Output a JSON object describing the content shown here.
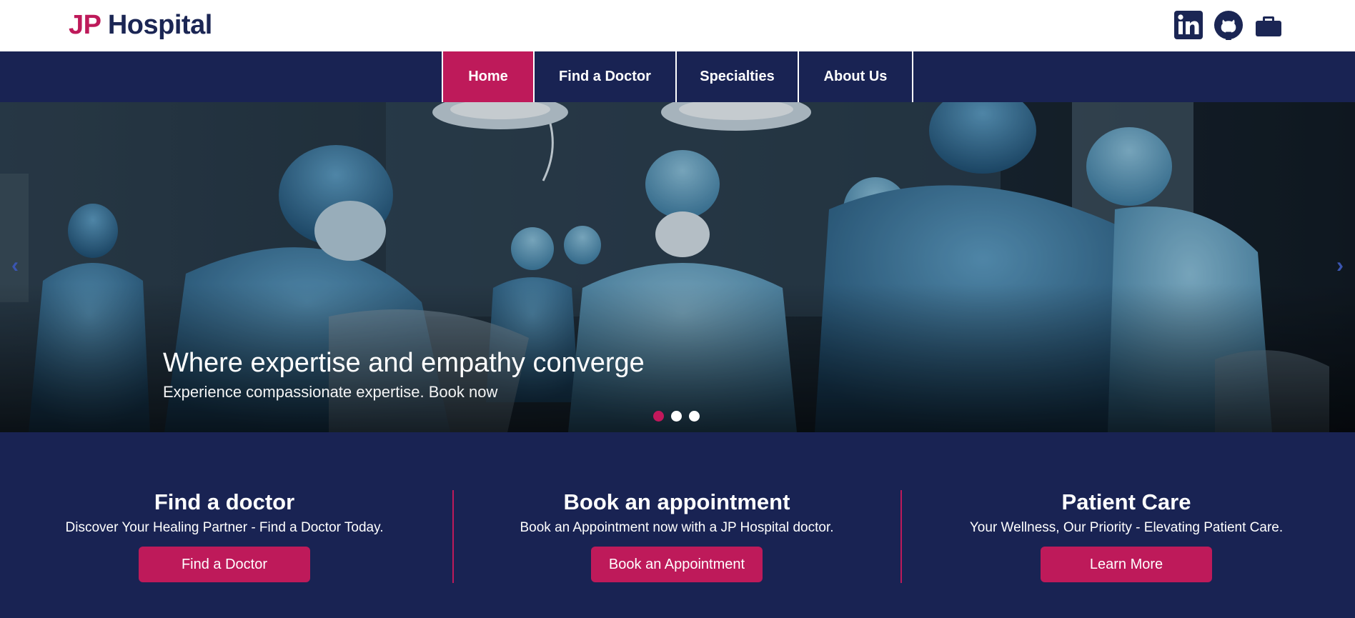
{
  "header": {
    "logo_jp": "JP",
    "logo_hospital": "Hospital",
    "social_icons": [
      "linkedin-icon",
      "github-icon",
      "briefcase-icon"
    ]
  },
  "nav": {
    "items": [
      {
        "label": "Home",
        "active": true
      },
      {
        "label": "Find a Doctor",
        "active": false
      },
      {
        "label": "Specialties",
        "active": false
      },
      {
        "label": "About Us",
        "active": false
      }
    ]
  },
  "hero": {
    "title": "Where expertise and empathy converge",
    "subtitle": "Experience compassionate expertise. Book now",
    "prev_arrow": "‹",
    "next_arrow": "›",
    "slide_count": 3,
    "active_slide": 1
  },
  "cards": [
    {
      "title": "Find a doctor",
      "text": "Discover Your Healing Partner - Find a Doctor Today.",
      "button": "Find a Doctor"
    },
    {
      "title": "Book an appointment",
      "text": "Book an Appointment now with a JP Hospital doctor.",
      "button": "Book an Appointment"
    },
    {
      "title": "Patient Care",
      "text": "Your Wellness, Our Priority - Elevating Patient Care.",
      "button": "Learn More"
    }
  ],
  "colors": {
    "brand_pink": "#be1a5a",
    "brand_navy": "#192353"
  }
}
